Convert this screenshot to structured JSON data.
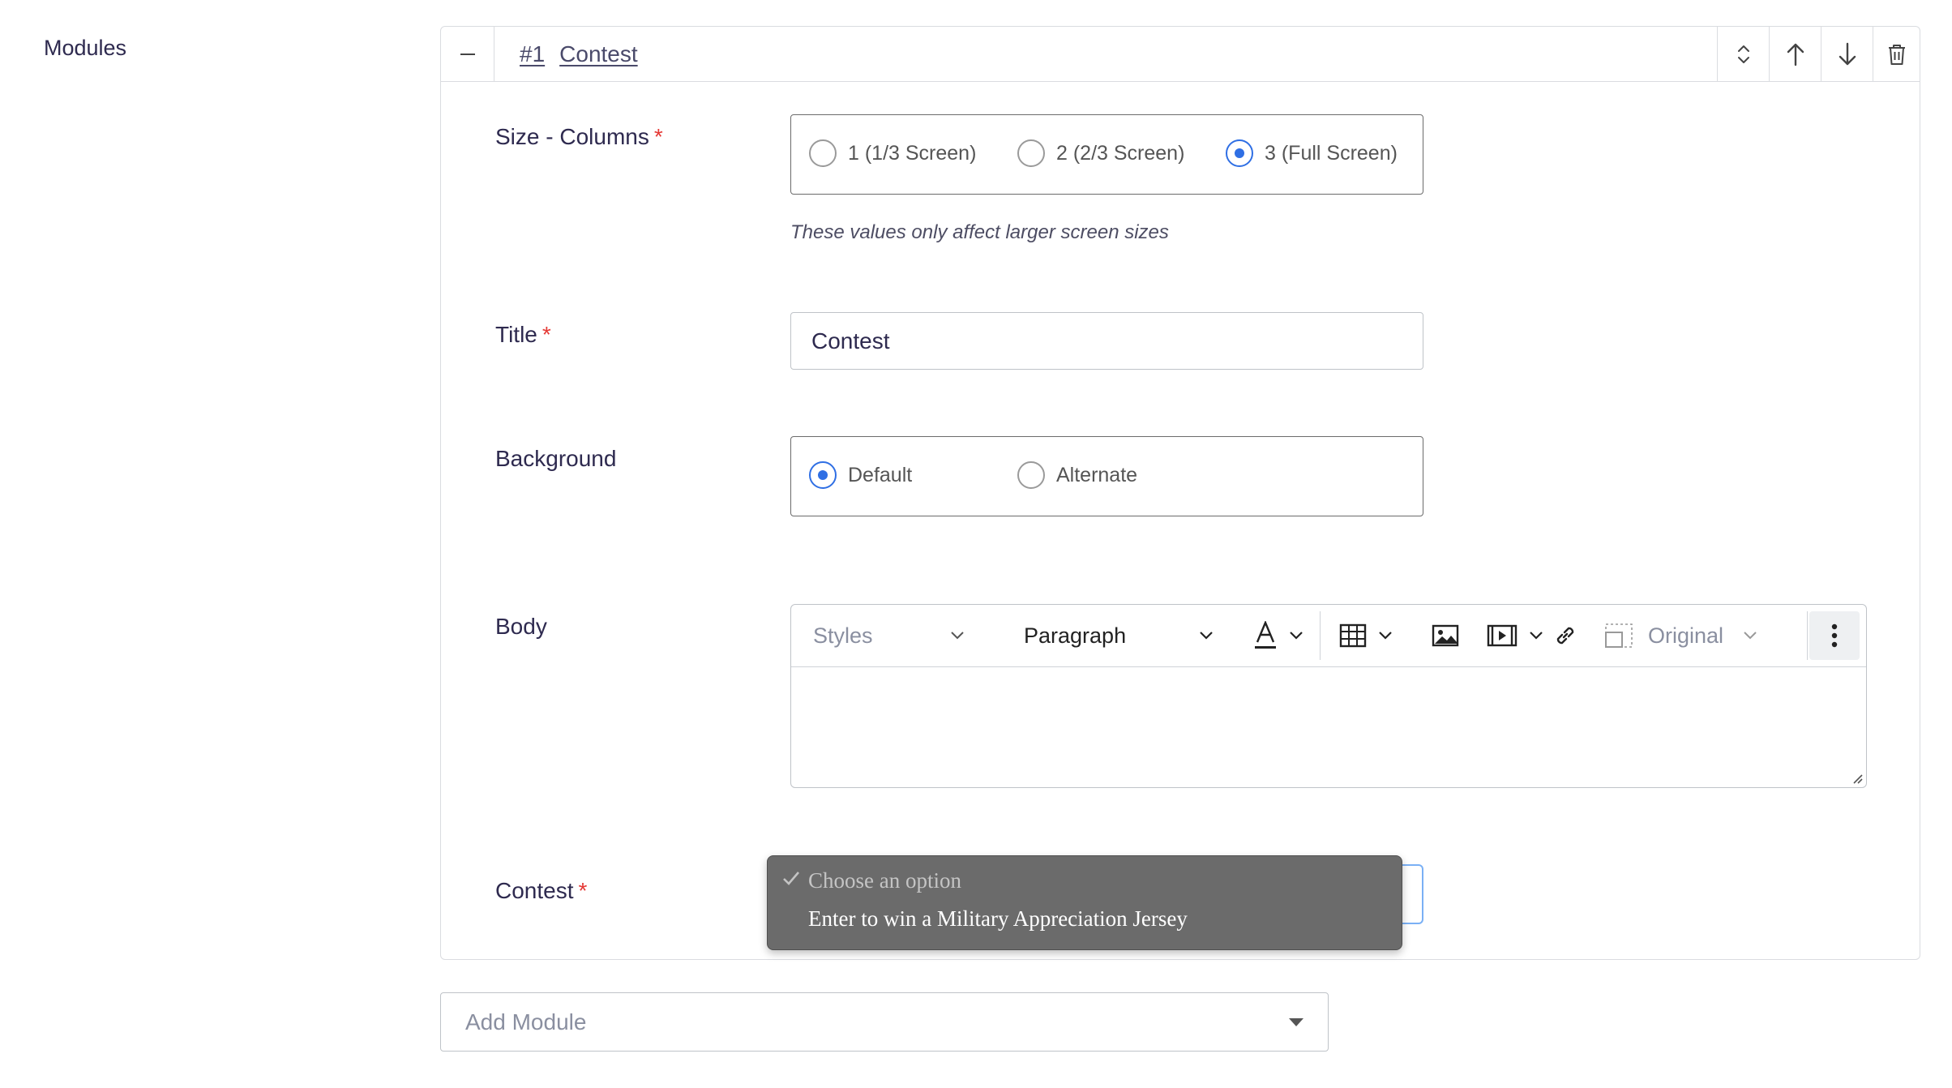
{
  "section_label": "Modules",
  "module": {
    "number": "#1",
    "name": "Contest",
    "header_icons": [
      "collapse-icon",
      "reorder-icon",
      "arrow-up-icon",
      "arrow-down-icon",
      "trash-icon"
    ]
  },
  "fields": {
    "size": {
      "label": "Size - Columns",
      "required": "*",
      "options": [
        "1 (1/3 Screen)",
        "2 (2/3 Screen)",
        "3 (Full Screen)"
      ],
      "selected": "3 (Full Screen)",
      "help": "These values only affect larger screen sizes"
    },
    "title": {
      "label": "Title",
      "required": "*",
      "value": "Contest"
    },
    "background": {
      "label": "Background",
      "options": [
        "Default",
        "Alternate"
      ],
      "selected": "Default"
    },
    "body": {
      "label": "Body",
      "toolbar": {
        "styles": "Styles",
        "block_format": "Paragraph",
        "image_size": "Original",
        "icons": [
          "text-color-icon",
          "table-icon",
          "image-icon",
          "media-icon",
          "link-icon",
          "image-resize-icon",
          "more-icon"
        ]
      },
      "value": ""
    },
    "contest": {
      "label": "Contest",
      "required": "*",
      "dropdown": {
        "placeholder": "Choose an option",
        "options": [
          "Enter to win a Military Appreciation Jersey"
        ]
      }
    }
  },
  "add_module": {
    "placeholder": "Add Module"
  },
  "colors": {
    "accent": "#2f6fe4",
    "required": "#e53935",
    "dropdown_bg": "#6b6b6b",
    "text": "#2e2a4f"
  }
}
